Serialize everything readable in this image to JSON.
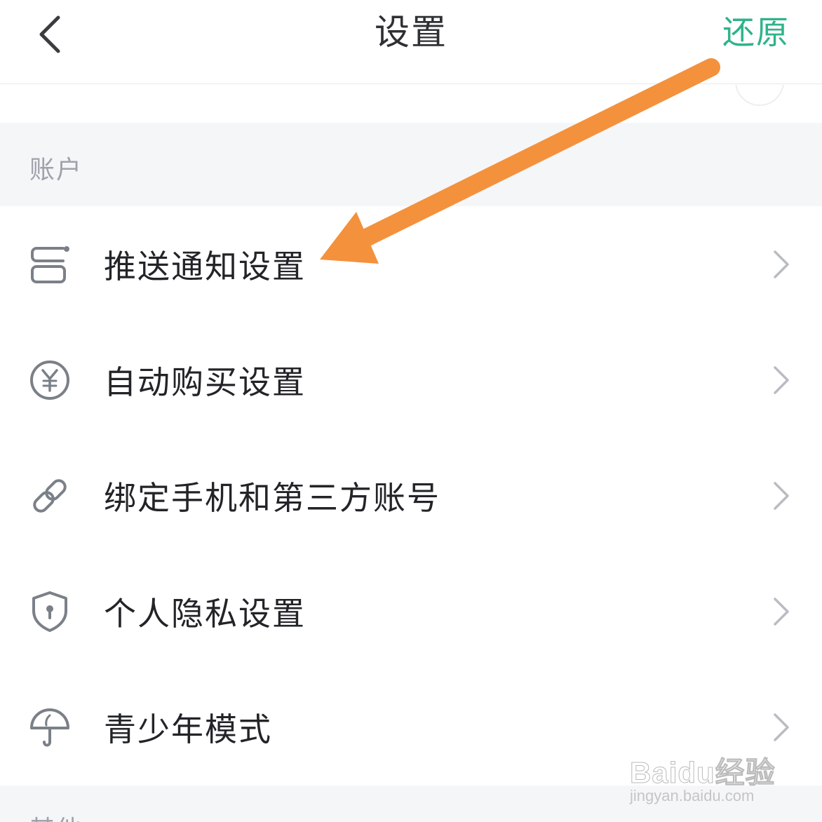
{
  "header": {
    "title": "设置",
    "restore_label": "还原",
    "accent_color": "#2fb38a"
  },
  "sections": {
    "account_title": "账户",
    "other_title_partial": "其他"
  },
  "items": [
    {
      "label": "推送通知设置",
      "icon": "push-notification-icon"
    },
    {
      "label": "自动购买设置",
      "icon": "yen-circle-icon"
    },
    {
      "label": "绑定手机和第三方账号",
      "icon": "link-chain-icon"
    },
    {
      "label": "个人隐私设置",
      "icon": "shield-lock-icon"
    },
    {
      "label": "青少年模式",
      "icon": "umbrella-icon"
    }
  ],
  "annotation": {
    "arrow_color": "#f4913c"
  },
  "watermark": {
    "brand": "Baidu经验",
    "url": "jingyan.baidu.com"
  }
}
